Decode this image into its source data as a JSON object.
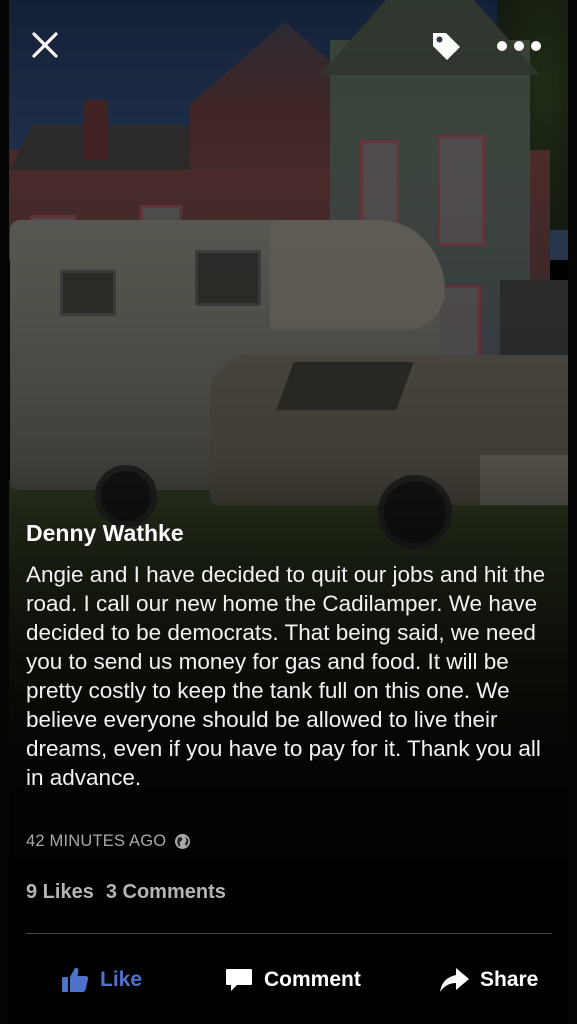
{
  "post": {
    "author": "Denny Wathke",
    "text": "Angie and I have decided to quit our jobs and hit the road. I call our new home the Cadilamper. We have decided to be democrats. That being said, we need you to send us money for gas and food. It will be pretty costly to keep the tank full on this one. We believe everyone should be allowed to live their dreams, even if you have to pay for it. Thank you all in advance.",
    "timestamp": "42 MINUTES AGO",
    "privacy_icon": "globe-icon"
  },
  "stats": {
    "likes": "9 Likes",
    "comments": "3 Comments"
  },
  "actions": {
    "like_label": "Like",
    "comment_label": "Comment",
    "share_label": "Share"
  },
  "top_bar": {
    "close_icon": "close-icon",
    "tag_icon": "tag-icon",
    "more_icon": "more-icon"
  },
  "colors": {
    "like_accent": "#4c72c9",
    "meta_gray": "#a9a9a9"
  }
}
